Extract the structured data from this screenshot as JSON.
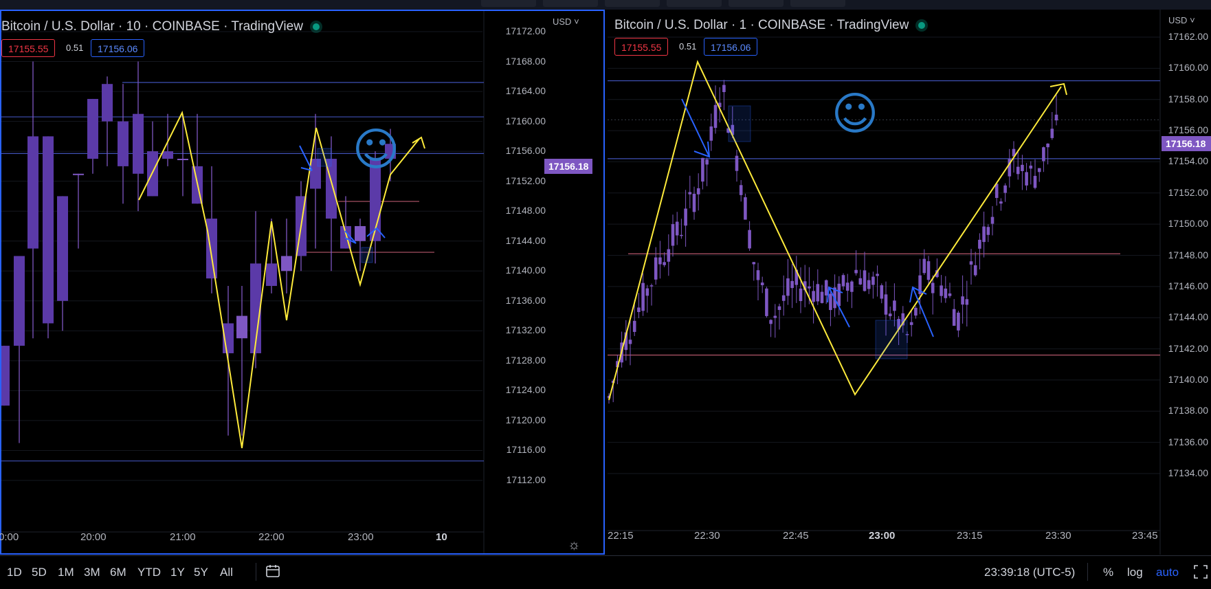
{
  "colors": {
    "candle": "#7e57c2",
    "candle_down": "#5b3aa8",
    "zigzag": "#ffeb3b",
    "arrow": "#2962ff",
    "hline_blue": "#3f51b5",
    "hline_red": "#b4576b",
    "smiley": "#2979c7"
  },
  "left_chart": {
    "title": "Bitcoin / U.S. Dollar · 10 · COINBASE · TradingView",
    "bid": "17155.55",
    "spread": "0.51",
    "ask": "17156.06",
    "currency": "USD",
    "y_ticks": [
      "17172.00",
      "17168.00",
      "17164.00",
      "17160.00",
      "17156.00",
      "17152.00",
      "17148.00",
      "17144.00",
      "17140.00",
      "17136.00",
      "17132.00",
      "17128.00",
      "17124.00",
      "17120.00",
      "17116.00",
      "17112.00"
    ],
    "x_ticks": [
      "0:00",
      "20:00",
      "21:00",
      "22:00",
      "23:00",
      "10"
    ],
    "last_price": "17156.18",
    "smiley": "☺",
    "y_range": [
      17112,
      17172
    ]
  },
  "right_chart": {
    "title": "Bitcoin / U.S. Dollar · 1 · COINBASE · TradingView",
    "bid": "17155.55",
    "spread": "0.51",
    "ask": "17156.06",
    "currency": "USD",
    "y_ticks": [
      "17162.00",
      "17160.00",
      "17158.00",
      "17156.00",
      "17154.00",
      "17152.00",
      "17150.00",
      "17148.00",
      "17146.00",
      "17144.00",
      "17142.00",
      "17140.00",
      "17138.00",
      "17136.00",
      "17134.00"
    ],
    "x_ticks": [
      "22:15",
      "22:30",
      "22:45",
      "23:00",
      "23:15",
      "23:30",
      "23:45"
    ],
    "last_price": "17156.18",
    "smiley": "☺",
    "y_range": [
      17134,
      17162
    ]
  },
  "bottom_bar": {
    "ranges": [
      "1D",
      "5D",
      "1M",
      "3M",
      "6M",
      "YTD",
      "1Y",
      "5Y",
      "All"
    ],
    "clock": "23:39:18 (UTC-5)",
    "percent": "%",
    "log": "log",
    "auto": "auto"
  }
}
